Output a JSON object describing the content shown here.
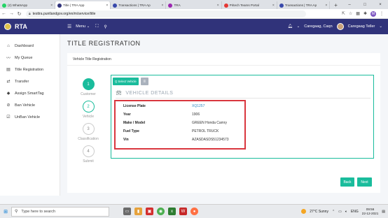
{
  "browser": {
    "tabs": [
      {
        "title": "(2) WhatsApp",
        "color": "#25d366",
        "active": false
      },
      {
        "title": "Title | TRA App",
        "color": "#30337a",
        "active": true
      },
      {
        "title": "Transactions | TRA Ap",
        "color": "#3949ab",
        "active": false
      },
      {
        "title": "TRA",
        "color": "#9c27b0",
        "active": false
      },
      {
        "title": "Pritech Teams Portal",
        "color": "#e53935",
        "active": false
      },
      {
        "title": "Transactions | TRA Ap",
        "color": "#3949ab",
        "active": false
      }
    ],
    "url": "testtra.puntlandgov.org/en/m/service/title",
    "profile_initial": "M"
  },
  "app": {
    "brand": "RTA",
    "menu_label": "Menu",
    "user_name": "Caregaag, Caqn",
    "user_role": "Caregaag Teller"
  },
  "sidebar": {
    "items": [
      {
        "label": "Dashboard",
        "icon": "home-icon",
        "glyph": "⌂"
      },
      {
        "label": "My Queue",
        "icon": "queue-icon",
        "glyph": "〰"
      },
      {
        "label": "Title Registration",
        "icon": "doc-icon",
        "glyph": "▤"
      },
      {
        "label": "Transfer",
        "icon": "transfer-icon",
        "glyph": "⇄"
      },
      {
        "label": "Assign SmartTag",
        "icon": "tag-icon",
        "glyph": "◆"
      },
      {
        "label": "Ban Vehicle",
        "icon": "ban-icon",
        "glyph": "⊘"
      },
      {
        "label": "UnBan Vehicle",
        "icon": "check-icon",
        "glyph": "☑"
      }
    ]
  },
  "page": {
    "title": "TITLE REGISTRATION",
    "card_title": "Vehicle Title Registration"
  },
  "steps": [
    {
      "num": "1",
      "label": "Customer",
      "state": "done"
    },
    {
      "num": "2",
      "label": "Vehicle",
      "state": "current"
    },
    {
      "num": "3",
      "label": "Classification",
      "state": "pending"
    },
    {
      "num": "4",
      "label": "Submit",
      "state": "pending"
    }
  ],
  "panel": {
    "select_vehicle_label": "Q Select Vehicle",
    "details_heading": "VEHICLE DETAILS",
    "fields": [
      {
        "key": "License Plate",
        "value": "XQ1257",
        "link": true
      },
      {
        "key": "Year",
        "value": "1906",
        "link": false
      },
      {
        "key": "Make / Model",
        "value": "GREEN Honda Camry",
        "link": false
      },
      {
        "key": "Fuel Type",
        "value": "PETROL TRUCK",
        "link": false
      },
      {
        "key": "Vin",
        "value": "AZASDASDS51234573",
        "link": false
      }
    ],
    "back_label": "Back",
    "next_label": "Next"
  },
  "taskbar": {
    "search_placeholder": "Type here to search",
    "weather": "27°C  Sunny",
    "lang": "ENG",
    "time": "09:56",
    "date": "22-12-2021"
  }
}
